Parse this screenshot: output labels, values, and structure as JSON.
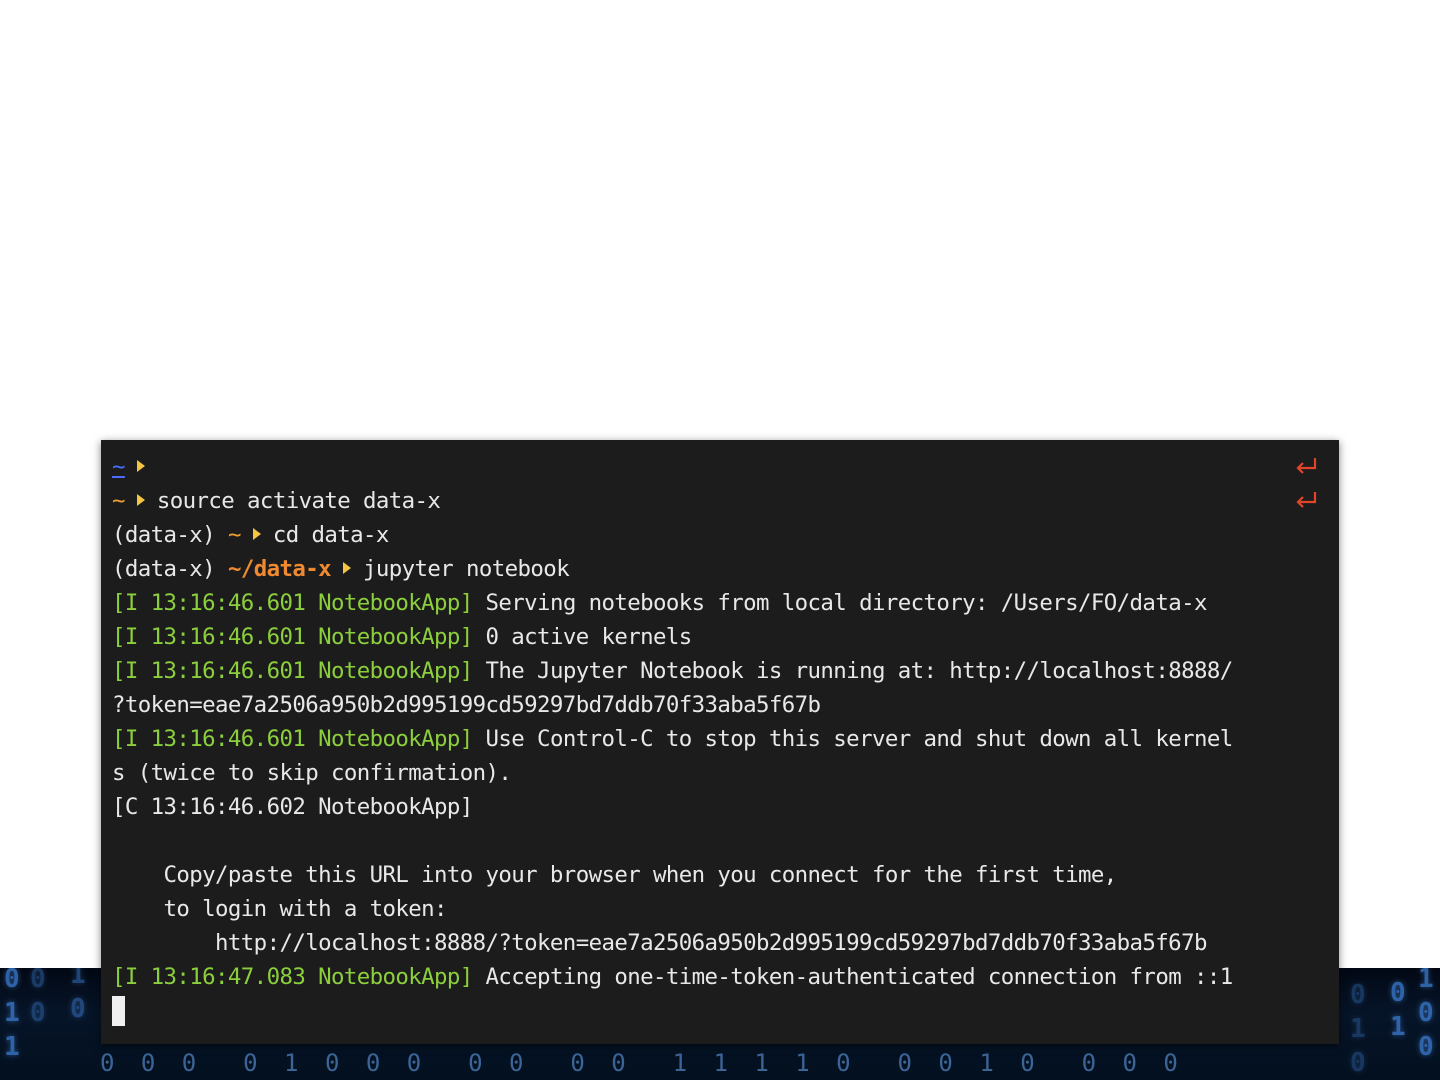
{
  "background": {
    "binary_columns": [
      "0\n1\n1",
      "0\n0",
      "1\n0",
      "0\n1",
      "1\n0\n0",
      "0\n1\n0",
      "0\n0"
    ],
    "binary_row": "0 0 0  0 1 0 0 0  0 0  0 0  1 1 1 1 0  0 0 1 0  0 0 0"
  },
  "terminal": {
    "colors": {
      "background": "#1c1c1c",
      "prompt_tilde": "#f0a030",
      "prompt_path": "#f08a30",
      "prompt_arrow": "#f5c542",
      "log_prefix": "#8ccf3c",
      "enter_icon": "#e0452a"
    },
    "prompt_home": "~",
    "prompt_env": "(data-x)",
    "prompt_path_dir": "~/data-x",
    "cmd_source": "source activate data-x",
    "cmd_cd": "cd data-x",
    "cmd_jupyter": "jupyter notebook",
    "log_prefix": "[I 13:16:46.601 NotebookApp]",
    "log_prefix_c": "[C 13:16:46.602 NotebookApp]",
    "log_prefix_last": "[I 13:16:47.083 NotebookApp]",
    "msg_serving": " Serving notebooks from local directory: /Users/FO/data-x",
    "msg_kernels": " 0 active kernels",
    "msg_running": " The Jupyter Notebook is running at: http://localhost:8888/",
    "msg_running_cont": "?token=eae7a2506a950b2d995199cd59297bd7ddb70f33aba5f67b",
    "msg_control": " Use Control-C to stop this server and shut down all kernel",
    "msg_control_cont": "s (twice to skip confirmation).",
    "msg_copy_1": "    Copy/paste this URL into your browser when you connect for the first time,",
    "msg_copy_2": "    to login with a token:",
    "msg_url": "        http://localhost:8888/?token=eae7a2506a950b2d995199cd59297bd7ddb70f33aba5f67b",
    "msg_accept": " Accepting one-time-token-authenticated connection from ::1",
    "enter_icon_name": "return-arrow-icon",
    "cursor_icon_name": "block-cursor-icon"
  }
}
